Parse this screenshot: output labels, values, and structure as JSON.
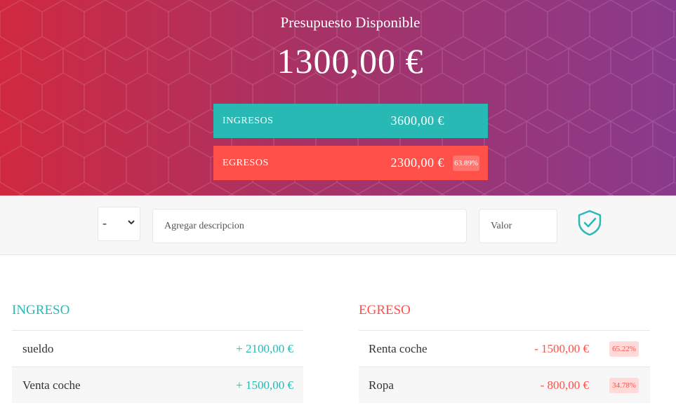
{
  "budget": {
    "title": "Presupuesto Disponible",
    "value": "1300,00 €"
  },
  "summary": {
    "income": {
      "label": "INGRESOS",
      "value": "3600,00 €"
    },
    "expense": {
      "label": "EGRESOS",
      "value": "2300,00 €",
      "percentage": "63.89%"
    }
  },
  "form": {
    "type_value": "-",
    "description_placeholder": "Agregar descripcion",
    "value_placeholder": "Valor",
    "submit_icon": "shield-check-icon"
  },
  "income_list": {
    "title": "INGRESO",
    "items": [
      {
        "description": "sueldo",
        "value": "+ 2100,00 €"
      },
      {
        "description": "Venta coche",
        "value": "+ 1500,00 €"
      }
    ]
  },
  "expense_list": {
    "title": "EGRESO",
    "items": [
      {
        "description": "Renta coche",
        "value": "- 1500,00 €",
        "percentage": "65.22%"
      },
      {
        "description": "Ropa",
        "value": "- 800,00 €",
        "percentage": "34.78%"
      }
    ]
  },
  "colors": {
    "income": "#28b9b5",
    "expense": "#ff5049",
    "header_start": "#d0293f",
    "header_end": "#8a3a8c"
  }
}
